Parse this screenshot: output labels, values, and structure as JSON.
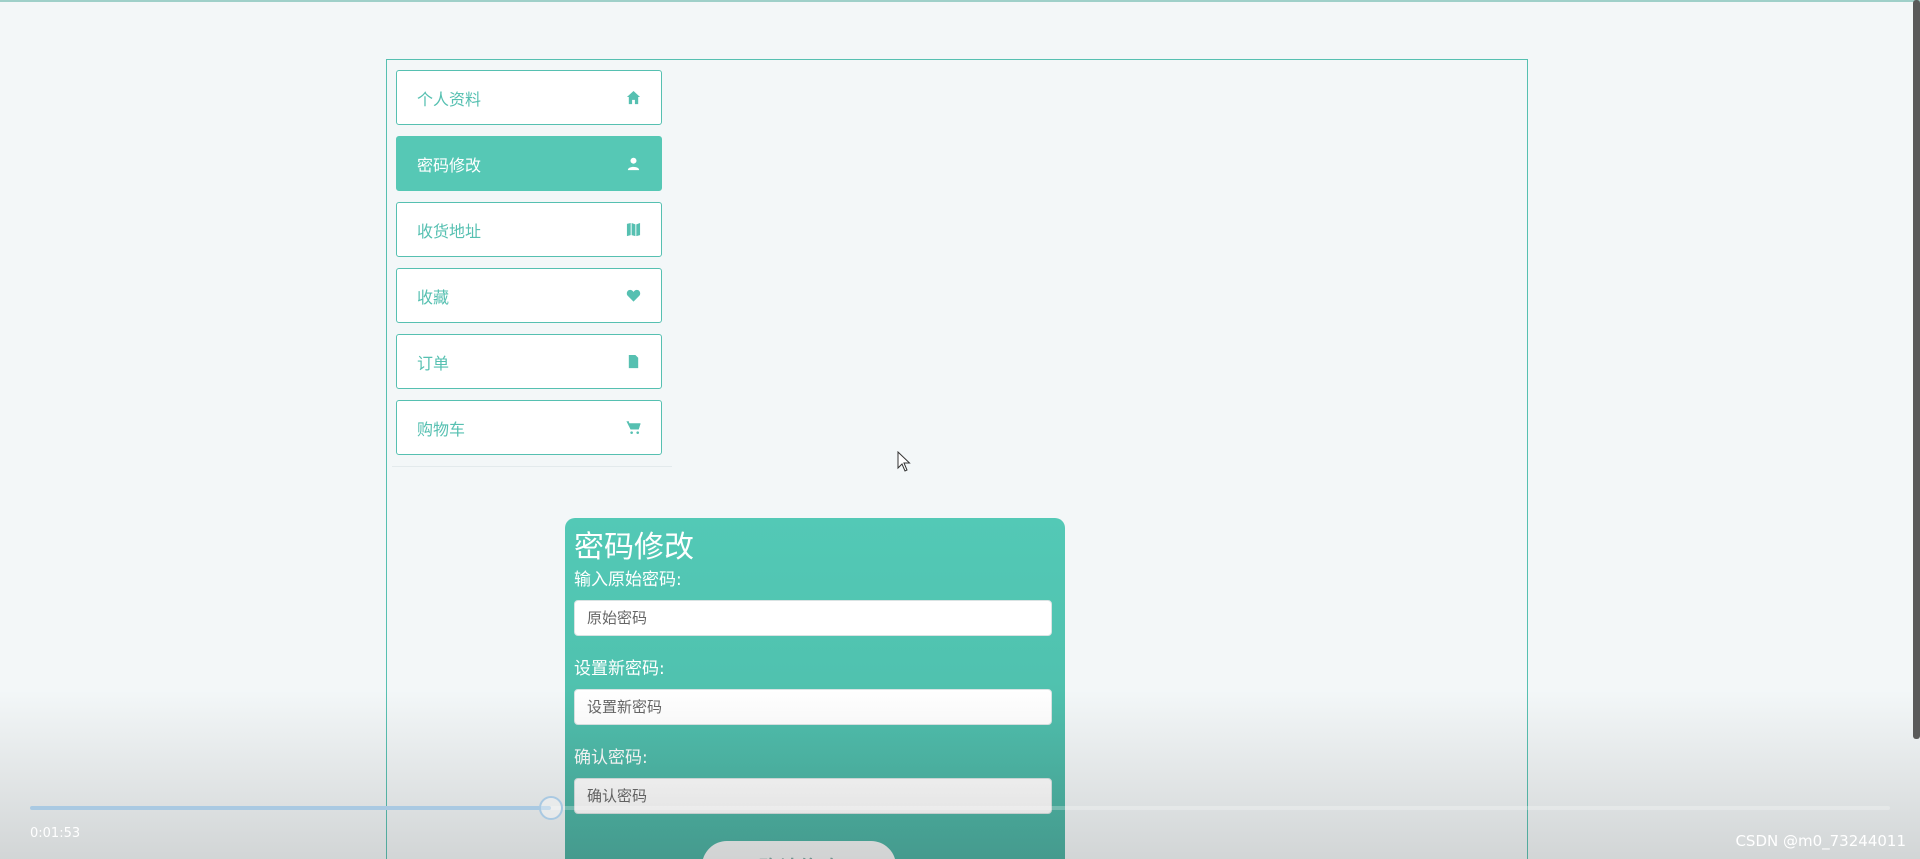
{
  "sidebar": {
    "items": [
      {
        "label": "个人资料",
        "icon": "home-icon",
        "active": false
      },
      {
        "label": "密码修改",
        "icon": "user-icon",
        "active": true
      },
      {
        "label": "收货地址",
        "icon": "map-icon",
        "active": false
      },
      {
        "label": "收藏",
        "icon": "heart-icon",
        "active": false
      },
      {
        "label": "订单",
        "icon": "file-icon",
        "active": false
      },
      {
        "label": "购物车",
        "icon": "cart-icon",
        "active": false
      }
    ]
  },
  "form": {
    "title": "密码修改",
    "old_label": "输入原始密码:",
    "old_placeholder": "原始密码",
    "new_label": "设置新密码:",
    "new_placeholder": "设置新密码",
    "confirm_label": "确认密码:",
    "confirm_placeholder": "确认密码",
    "submit_label": "确认修改"
  },
  "video": {
    "timecode": "0:01:53",
    "progress": 0.28
  },
  "watermark": "CSDN @m0_73244011",
  "colors": {
    "accent": "#56c8b5",
    "border": "#56c0b1"
  }
}
